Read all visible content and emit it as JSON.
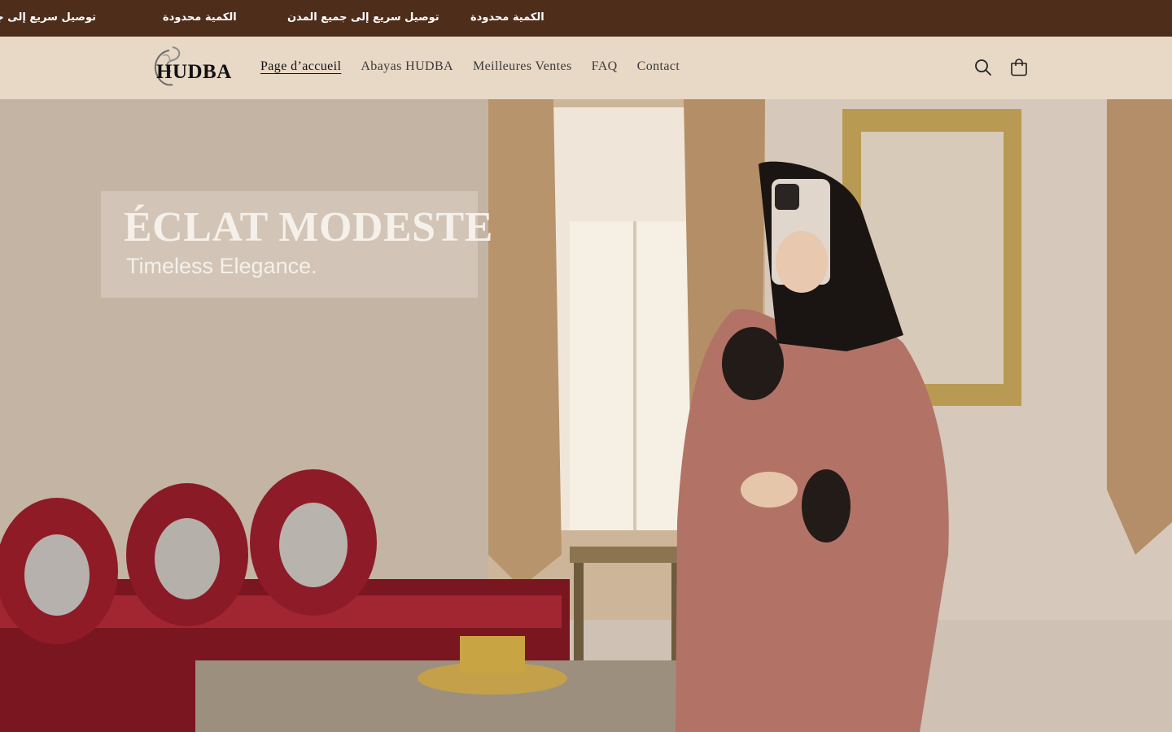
{
  "announcement": {
    "messages": [
      "توصيل سريع إلى جميع المدن",
      "الكمية محدودة",
      "توصيل سريع إلى جميع المدن",
      "الكمية محدودة"
    ]
  },
  "header": {
    "logo_text": "HUDBA",
    "nav": [
      {
        "label": "Page d’accueil",
        "active": true
      },
      {
        "label": "Abayas HUDBA",
        "active": false
      },
      {
        "label": "Meilleures Ventes",
        "active": false
      },
      {
        "label": "FAQ",
        "active": false
      },
      {
        "label": "Contact",
        "active": false
      }
    ],
    "icons": [
      "search-icon",
      "cart-icon"
    ]
  },
  "hero": {
    "title": "ÉCLAT MODESTE",
    "subtitle": "Timeless Elegance."
  },
  "colors": {
    "announcement_bg": "#4e2d1b",
    "header_bg": "#e8d8c6",
    "text": "#121212"
  }
}
